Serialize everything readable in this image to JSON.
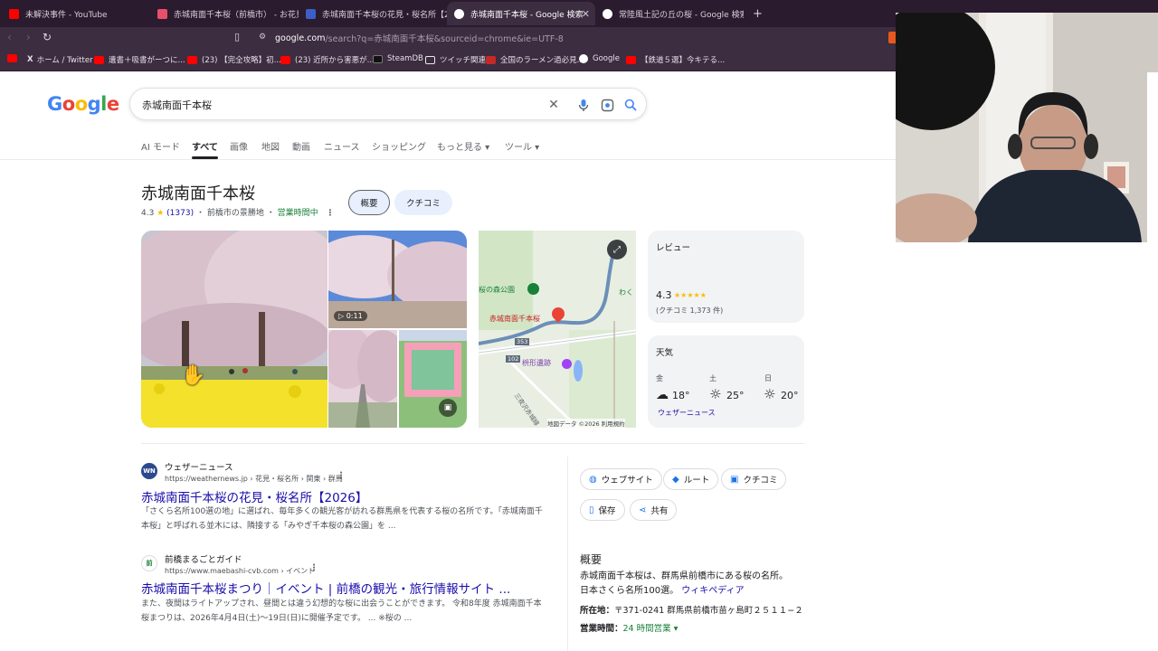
{
  "browser": {
    "tabs": [
      {
        "title": "未解決事件 - YouTube",
        "color": "#ff0000"
      },
      {
        "title": "赤城南面千本桜（前橋市） - お花見",
        "color": "#e94f6a"
      },
      {
        "title": "赤城南面千本桜の花見・桜名所【2026】",
        "color": "#3b5fc7"
      },
      {
        "title": "赤城南面千本桜 - Google 検索",
        "color": "#ffffff"
      },
      {
        "title": "常陸風土記の丘の桜 - Google 検索",
        "color": "#ffffff"
      }
    ],
    "new_tab": "+",
    "close": "✕",
    "url_host": "google.com",
    "url_rest": "/search?q=赤城南面千本桜&sourceid=chrome&ie=UTF-8",
    "bookmarks": [
      {
        "label": "",
        "color": "#ff0000"
      },
      {
        "label": "ホーム / Twitter",
        "color": "#111111"
      },
      {
        "label": "遺書＋吸書がーつに...",
        "color": "#ff0000"
      },
      {
        "label": "(23) 【完全攻略】初...",
        "color": "#ff0000"
      },
      {
        "label": "(23) 近所から害悪が...",
        "color": "#ff0000"
      },
      {
        "label": "SteamDB",
        "color": "#111111"
      },
      {
        "label": "ツイッチ関連",
        "color": "#e8e8e8"
      },
      {
        "label": "全国のラーメン過必見...",
        "color": "#c62828"
      },
      {
        "label": "Google",
        "color": "#ffffff"
      },
      {
        "label": "【鉄道５選】今キテる...",
        "color": "#ff0000"
      }
    ]
  },
  "search": {
    "logo": "Google",
    "query": "赤城南面千本桜",
    "tabs": [
      "AI モード",
      "すべて",
      "画像",
      "地図",
      "動画",
      "ニュース",
      "ショッピング",
      "もっと見る ▾",
      "ツール ▾"
    ]
  },
  "knowledge": {
    "title": "赤城南面千本桜",
    "rating": "4.3",
    "stars": "★",
    "count": "(1373)",
    "category": "前橋市の景勝地",
    "status": "営業時間中",
    "chips": [
      "概要",
      "クチコミ"
    ],
    "video_time": "▷ 0:11",
    "map": {
      "place": "赤城南面千本桜",
      "park": "桜の森公園",
      "site": "枡形遺跡",
      "waku": "わく",
      "road1": "353",
      "road2": "102",
      "river": "三夜沢赤城線",
      "footer": "地図データ ©2026  利用規約"
    },
    "review_card": {
      "label": "レビュー",
      "score": "4.3",
      "stars": "★★★★★",
      "count": "(クチコミ 1,373 件)"
    },
    "weather_card": {
      "label": "天気",
      "days": [
        {
          "day": "金",
          "icon": "☁",
          "temp": "18°"
        },
        {
          "day": "土",
          "icon": "☼",
          "temp": "25°"
        },
        {
          "day": "日",
          "icon": "☼",
          "temp": "20°"
        }
      ],
      "source": "ウェザーニュース"
    }
  },
  "results": [
    {
      "fav": "WN",
      "site": "ウェザーニュース",
      "url": "https://weathernews.jp › 花見・桜名所 › 関東 › 群馬",
      "title": "赤城南面千本桜の花見・桜名所【2026】",
      "snippet": "「さくら名所100選の地」に選ばれ、毎年多くの観光客が訪れる群馬県を代表する桜の名所です。「赤城南面千本桜」と呼ばれる並木には、隣接する「みやぎ千本桜の森公園」を ..."
    },
    {
      "fav": "前",
      "site": "前橋まるごとガイド",
      "url": "https://www.maebashi-cvb.com › イベント",
      "title": "赤城南面千本桜まつり｜イベント | 前橋の観光・旅行情報サイト ...",
      "snippet": "また、夜間はライトアップされ、昼間とは違う幻想的な桜に出会うことができます。 令和8年度 赤城南面千本桜まつりは、2026年4月4日(土)～19日(日)に開催予定です。 ... ※桜の ..."
    }
  ],
  "side": {
    "actions": [
      {
        "icon": "◍",
        "label": "ウェブサイト"
      },
      {
        "icon": "◆",
        "label": "ルート"
      },
      {
        "icon": "▣",
        "label": "クチコミ"
      },
      {
        "icon": "▯",
        "label": "保存"
      },
      {
        "icon": "⋖",
        "label": "共有"
      }
    ],
    "overview_heading": "概要",
    "overview_line1": "赤城南面千本桜は、群馬県前橋市にある桜の名所。",
    "overview_line2": "日本さくら名所100選。",
    "wiki": "ウィキペディア",
    "address_label": "所在地：",
    "address": "〒371-0241 群馬県前橋市苗ヶ島町２５１１−２",
    "hours_label": "営業時間：",
    "hours": "24 時間営業 ▾"
  }
}
